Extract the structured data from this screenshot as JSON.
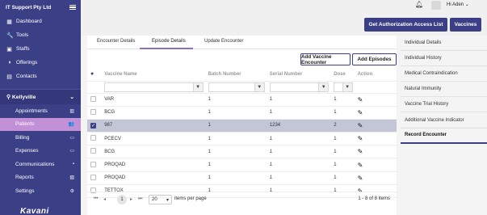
{
  "sidebar": {
    "company": "IT Support Pty Ltd",
    "menu": [
      {
        "label": "Dashboard",
        "icon": "dashboard-icon",
        "glyph": "▦"
      },
      {
        "label": "Tools",
        "icon": "wrench-icon",
        "glyph": "🔧"
      },
      {
        "label": "Staffs",
        "icon": "staff-icon",
        "glyph": "▣"
      },
      {
        "label": "Offerings",
        "icon": "offerings-icon",
        "glyph": "◑"
      },
      {
        "label": "Contacts",
        "icon": "contacts-icon",
        "glyph": "▤"
      }
    ],
    "location": "Kellyville",
    "location_icon": "location-pin-icon",
    "submenu": [
      {
        "label": "Appointments",
        "glyph": "▥"
      },
      {
        "label": "Patients",
        "glyph": "👥"
      },
      {
        "label": "Billing",
        "glyph": "▭"
      },
      {
        "label": "Expenses",
        "glyph": "▭"
      },
      {
        "label": "Communications",
        "glyph": "▪"
      },
      {
        "label": "Reports",
        "glyph": "▧"
      },
      {
        "label": "Settings",
        "glyph": "⚙"
      }
    ],
    "logo": "Kavani"
  },
  "topbar": {
    "user_greeting": "Hi Aden",
    "auth_button": "Get Authorization Access List",
    "vaccines_button": "Vaccines"
  },
  "tabs": {
    "t1": "Encounter Details",
    "t2": "Episode Details",
    "t3": "Update Encounter"
  },
  "actions": {
    "add_vaccine_encounter": "Add Vaccine Encounter",
    "add_episodes": "Add Episodes"
  },
  "table": {
    "columns": {
      "name": "Vaccine Name",
      "batch": "Batch Number",
      "serial": "Serial Number",
      "dose": "Dose",
      "action": "Action"
    },
    "rows": [
      {
        "name": "VAR",
        "batch": "1",
        "serial": "1",
        "dose": "1",
        "selected": false
      },
      {
        "name": "BCG",
        "batch": "1",
        "serial": "1",
        "dose": "1",
        "selected": false
      },
      {
        "name": "987",
        "batch": "1",
        "serial": "1234",
        "dose": "2",
        "selected": true
      },
      {
        "name": "PCECV",
        "batch": "1",
        "serial": "1",
        "dose": "1",
        "selected": false
      },
      {
        "name": "BCG",
        "batch": "1",
        "serial": "1",
        "dose": "1",
        "selected": false
      },
      {
        "name": "PROQAD",
        "batch": "1",
        "serial": "1",
        "dose": "1",
        "selected": false
      },
      {
        "name": "PROQAD",
        "batch": "1",
        "serial": "1",
        "dose": "1",
        "selected": false
      },
      {
        "name": "TETTOX",
        "batch": "1",
        "serial": "1",
        "dose": "1",
        "selected": false
      }
    ]
  },
  "pager": {
    "current_page": "1",
    "page_size": "20",
    "items_per_page_label": "items per page",
    "range": "1 - 8 of 8 items"
  },
  "right_menu": {
    "items": [
      "Individual Details",
      "Individual History",
      "Medical Contraindication",
      "Natural Immunity",
      "Vaccine Trial History",
      "Additional Vaccine Indicator",
      "Record Encounter"
    ],
    "active_index": 6
  },
  "colors": {
    "sidebar": "#3b3f86",
    "accent": "#c190d6",
    "selected_row": "#c3c6d7",
    "tab_underline": "#8a6fc4"
  }
}
